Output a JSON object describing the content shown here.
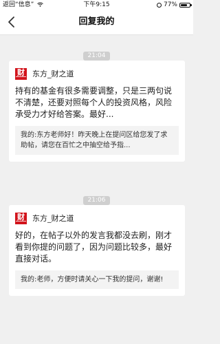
{
  "status_bar": {
    "back_to_app": "返回“信息”",
    "signal": "",
    "time": "下午9:15",
    "battery_text": "77%",
    "battery_level": 0.77,
    "icons": [
      "signal-icon",
      "wifi-icon",
      "alarm-icon",
      "battery-icon"
    ]
  },
  "nav": {
    "back_icon": "chevron-left-icon",
    "title": "回复我的"
  },
  "messages": [
    {
      "time": "21:04",
      "logo_text": "财",
      "sender": "东方_财之道",
      "reply": "持有的基金有很多需要调整，只是三两句说不清楚，还要对照每个人的投资风格，风险承受力才好给答案。最好...",
      "quote": "我的:东方老师好！昨天晚上在提问区给您发了求助帖，请您在百忙之中抽空给予指..."
    },
    {
      "time": "21:06",
      "logo_text": "财",
      "sender": "东方_财之道",
      "reply": "好的，在帖子以外的发言我都没去刷，刚才看到你提的问题了，因为问题比较多，最好直接对话。",
      "quote": "我的:老师，方便时请关心一下我的提问，谢谢!"
    }
  ],
  "colors": {
    "background": "#f0f0f0",
    "card": "#ffffff",
    "logo_red": "#d2141c",
    "time_badge": "#cfcfcf"
  }
}
